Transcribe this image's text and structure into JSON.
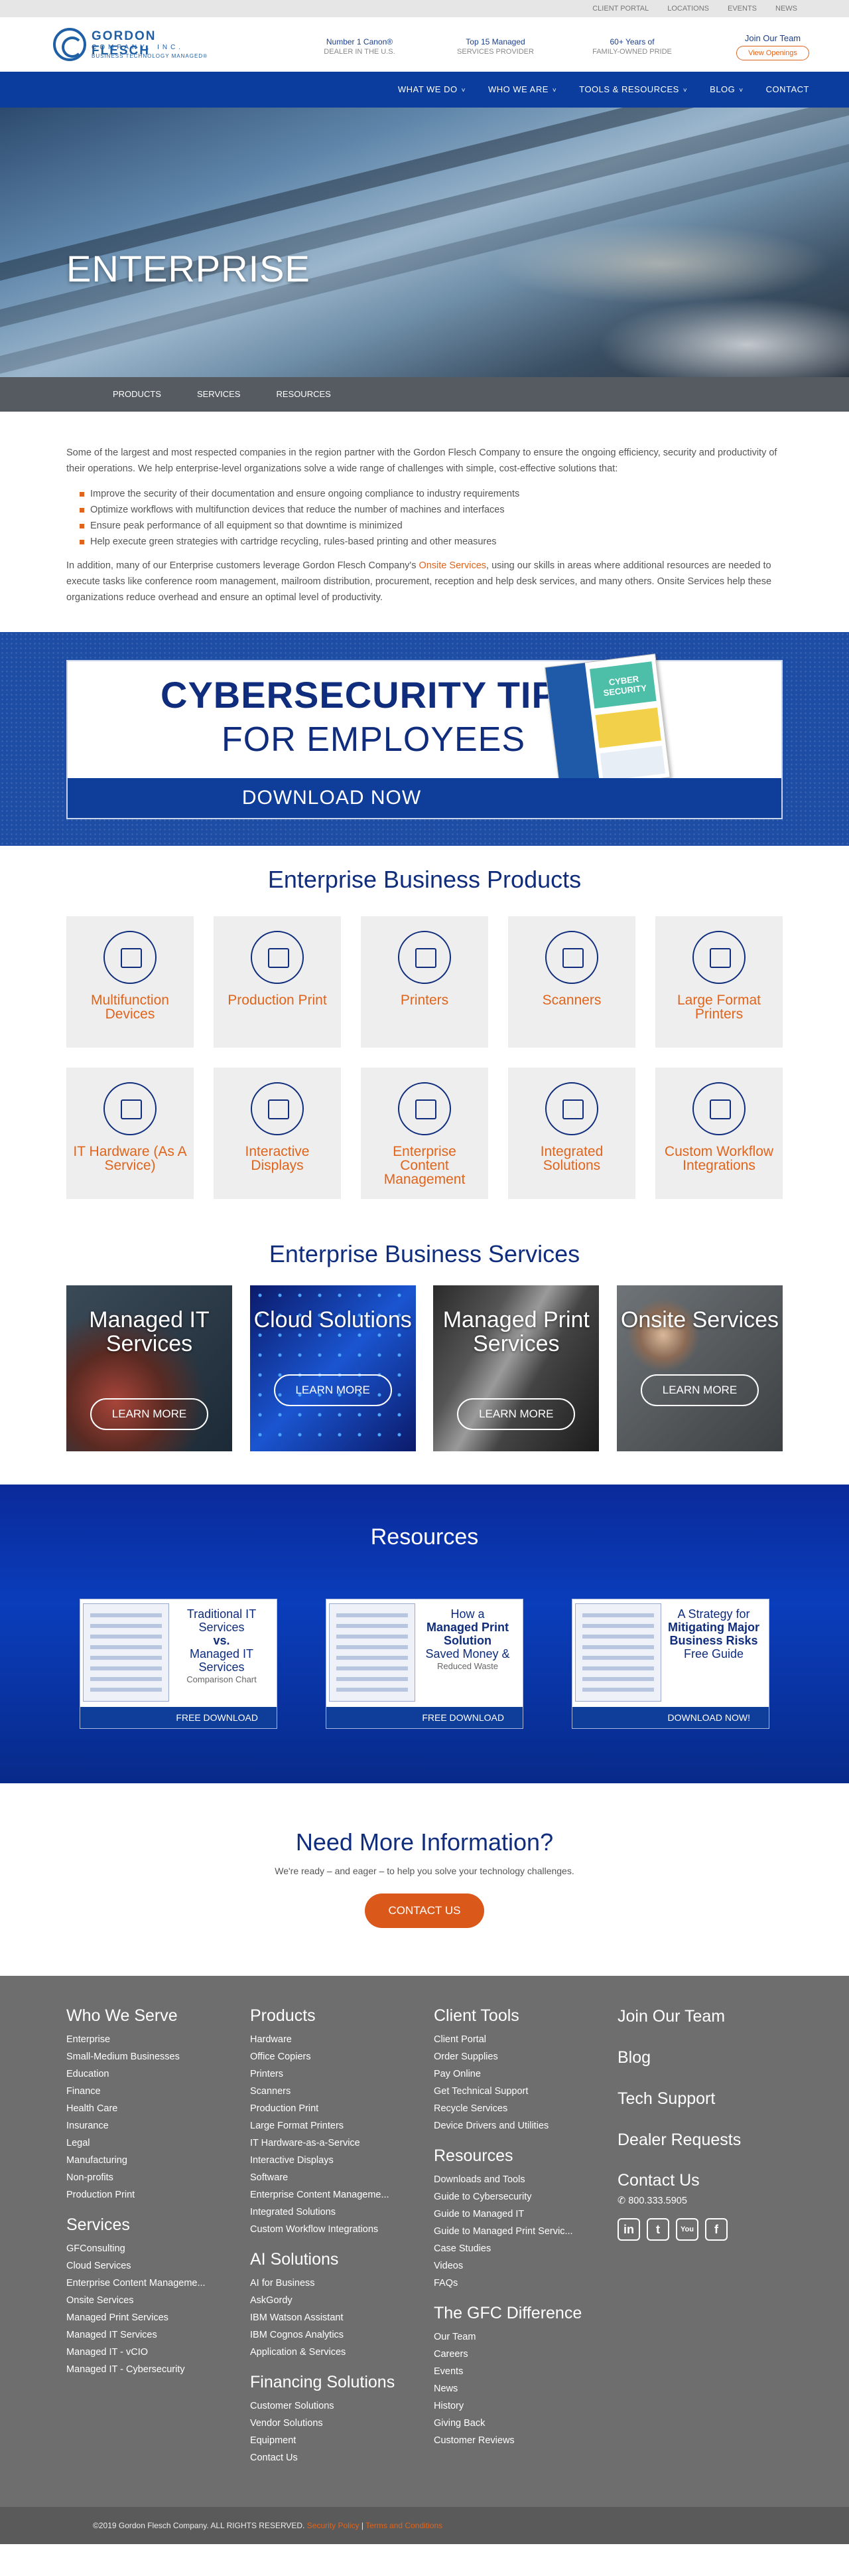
{
  "util_links": [
    "CLIENT PORTAL",
    "LOCATIONS",
    "EVENTS",
    "NEWS"
  ],
  "logo": {
    "line1": "GORDON FLESCH",
    "line2": "COMPANY, INC.",
    "line3": "BUSINESS TECHNOLOGY MANAGED®"
  },
  "stats": [
    {
      "a": "Number 1 Canon®",
      "b": "DEALER IN THE U.S."
    },
    {
      "a": "Top 15 Managed",
      "b": "SERVICES PROVIDER"
    },
    {
      "a": "60+ Years of",
      "b": "FAMILY-OWNED PRIDE"
    }
  ],
  "join": {
    "title": "Join Our Team",
    "button": "View Openings"
  },
  "nav": [
    "WHAT WE DO",
    "WHO WE ARE",
    "TOOLS & RESOURCES",
    "BLOG",
    "CONTACT"
  ],
  "hero": {
    "title": "ENTERPRISE"
  },
  "subnav": [
    "PRODUCTS",
    "SERVICES",
    "RESOURCES"
  ],
  "intro": {
    "p1": "Some of the largest and most respected companies in the region partner with the Gordon Flesch Company to ensure the ongoing efficiency, security and productivity of their operations. We help enterprise-level organizations solve a wide range of challenges with simple, cost-effective solutions that:",
    "bullets": [
      "Improve the security of their documentation and ensure ongoing compliance to industry requirements",
      "Optimize workflows with multifunction devices that reduce the number of machines and interfaces",
      "Ensure peak performance of all equipment so that downtime is minimized",
      "Help execute green strategies with cartridge recycling, rules-based printing and other measures"
    ],
    "p2_a": "In addition, many of our Enterprise customers leverage Gordon Flesch Company's ",
    "p2_link": "Onsite Services",
    "p2_b": ", using our skills in areas where additional resources are needed to execute tasks like conference room management, mailroom distribution, procurement, reception and help desk services, and many others. Onsite Services help these organizations reduce overhead and ensure an optimal level of productivity."
  },
  "cyber": {
    "t1": "CYBERSECURITY TIPS",
    "t2": "FOR EMPLOYEES",
    "cta": "DOWNLOAD NOW",
    "brochure": "CYBER SECURITY"
  },
  "products": {
    "title": "Enterprise Business Products",
    "items": [
      "Multifunction Devices",
      "Production Print",
      "Printers",
      "Scanners",
      "Large Format Printers",
      "IT Hardware (As A Service)",
      "Interactive Displays",
      "Enterprise Content Management",
      "Integrated Solutions",
      "Custom Workflow Integrations"
    ]
  },
  "services": {
    "title": "Enterprise Business Services",
    "items": [
      {
        "title": "Managed IT Services",
        "cta": "LEARN MORE"
      },
      {
        "title": "Cloud Solutions",
        "cta": "LEARN MORE"
      },
      {
        "title": "Managed Print Services",
        "cta": "LEARN MORE"
      },
      {
        "title": "Onsite Services",
        "cta": "LEARN MORE"
      }
    ]
  },
  "resources": {
    "title": "Resources",
    "items": [
      {
        "l1": "Traditional IT Services",
        "l2": "vs.",
        "l3": "Managed IT Services",
        "l4": "Comparison Chart",
        "cta": "FREE DOWNLOAD"
      },
      {
        "l1": "How a",
        "l2": "Managed Print Solution",
        "l3": "Saved Money &",
        "l4": "Reduced Waste",
        "cta": "FREE DOWNLOAD"
      },
      {
        "l1": "A Strategy for",
        "l2": "Mitigating Major Business Risks",
        "l3": "Free Guide",
        "l4": "",
        "cta": "DOWNLOAD NOW!"
      }
    ]
  },
  "need": {
    "title": "Need More Information?",
    "text": "We're ready – and eager – to help you solve your technology challenges.",
    "button": "CONTACT US"
  },
  "footer": {
    "col1": [
      {
        "h": "Who We Serve",
        "items": [
          "Enterprise",
          "Small-Medium Businesses",
          "Education",
          "Finance",
          "Health Care",
          "Insurance",
          "Legal",
          "Manufacturing",
          "Non-profits",
          "Production Print"
        ]
      },
      {
        "h": "Services",
        "items": [
          "GFConsulting",
          "Cloud Services",
          "Enterprise Content Manageme...",
          "Onsite Services",
          "Managed Print Services",
          "Managed IT Services",
          "Managed IT - vCIO",
          "Managed IT - Cybersecurity"
        ]
      }
    ],
    "col2": [
      {
        "h": "Products",
        "items": [
          "Hardware",
          "Office Copiers",
          "Printers",
          "Scanners",
          "Production Print",
          "Large Format Printers",
          "IT Hardware-as-a-Service",
          "Interactive Displays",
          "Software",
          "Enterprise Content Manageme...",
          "Integrated Solutions",
          "Custom Workflow Integrations"
        ]
      },
      {
        "h": "AI Solutions",
        "items": [
          "AI for Business",
          "AskGordy",
          "IBM Watson Assistant",
          "IBM Cognos Analytics",
          "Application & Services"
        ]
      },
      {
        "h": "Financing Solutions",
        "items": [
          "Customer Solutions",
          "Vendor Solutions",
          "Equipment",
          "Contact Us"
        ]
      }
    ],
    "col3": [
      {
        "h": "Client Tools",
        "items": [
          "Client Portal",
          "Order Supplies",
          "Pay Online",
          "Get Technical Support",
          "Recycle Services",
          "Device Drivers and Utilities"
        ]
      },
      {
        "h": "Resources",
        "items": [
          "Downloads and Tools",
          "Guide to Cybersecurity",
          "Guide to Managed IT",
          "Guide to Managed Print Servic...",
          "Case Studies",
          "Videos",
          "FAQs"
        ]
      },
      {
        "h": "The GFC Difference",
        "items": [
          "Our Team",
          "Careers",
          "Events",
          "News",
          "History",
          "Giving Back",
          "Customer Reviews"
        ]
      }
    ],
    "col4": [
      "Join Our Team",
      "Blog",
      "Tech Support",
      "Dealer Requests"
    ],
    "contact": {
      "h": "Contact Us",
      "phone": "800.333.5905"
    },
    "social": [
      "in",
      "t",
      "You",
      "f"
    ]
  },
  "copyright": {
    "text": "©2019 Gordon Flesch Company. ALL RIGHTS RESERVED.",
    "privacy": "Security Policy",
    "sep": "|",
    "terms": "Terms and Conditions"
  }
}
